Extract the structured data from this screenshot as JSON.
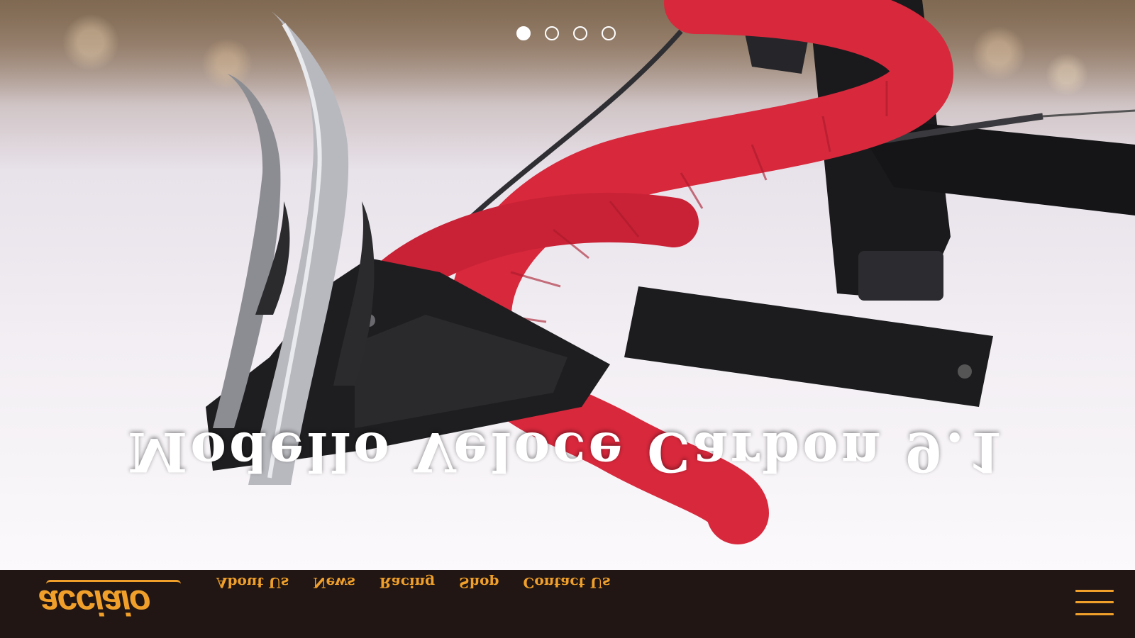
{
  "hero": {
    "title": "Modello Veloce Carbon 9.1",
    "slides": [
      {
        "label": "slide-1",
        "active": true
      },
      {
        "label": "slide-2",
        "active": false
      },
      {
        "label": "slide-3",
        "active": false
      },
      {
        "label": "slide-4",
        "active": false
      }
    ]
  },
  "navbar": {
    "logo_text": "acciaio",
    "links": [
      "About Us",
      "News",
      "Racing",
      "Shop",
      "Contact Us"
    ],
    "menu_icon": "hamburger-menu-icon"
  },
  "colors": {
    "accent": "#f0a02a",
    "navbar_bg": "#211614",
    "handlebar_tape": "#d8283c",
    "text_light": "#ffffff"
  }
}
